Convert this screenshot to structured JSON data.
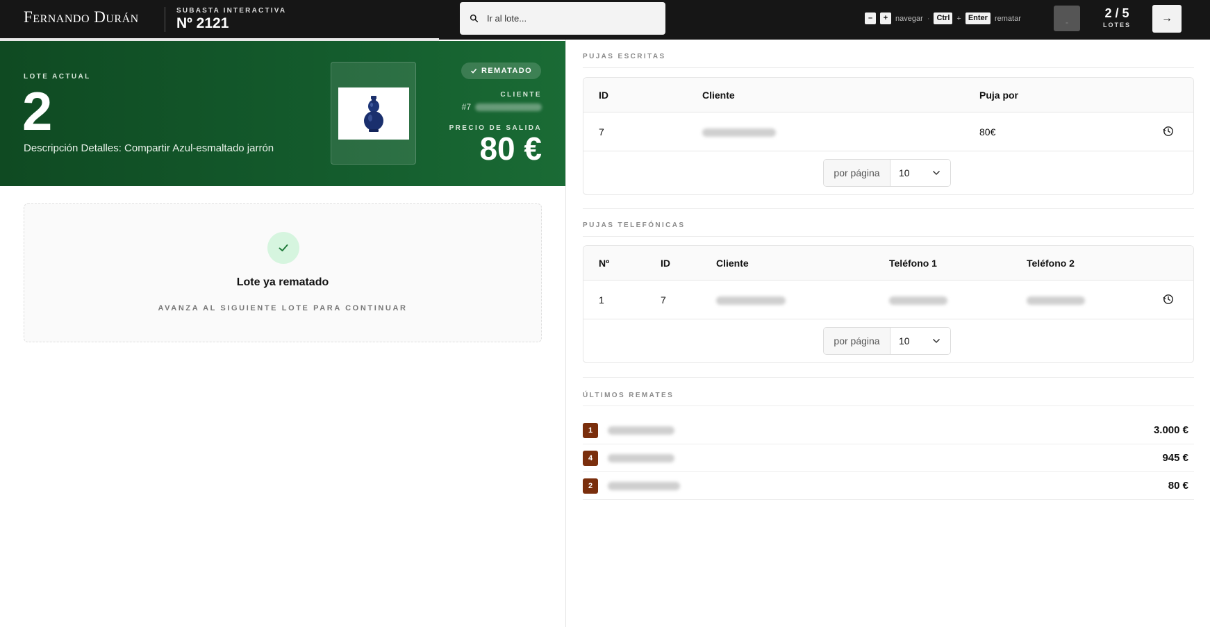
{
  "header": {
    "brand": "Fernando Durán",
    "auction_kicker": "SUBASTA INTERACTIVA",
    "auction_number": "Nº 2121",
    "search_placeholder": "Ir al lote...",
    "hint_minus": "–",
    "hint_plus": "+",
    "hint_navigate": "navegar",
    "hint_ctrl": "Ctrl",
    "hint_enter": "Enter",
    "hint_auction": "rematar",
    "stop_label": "-",
    "lot_counter": "2 / 5",
    "lot_counter_label": "LOTES",
    "next_label": "→",
    "progress_fraction": 0.4
  },
  "current_lot": {
    "kicker": "LOTE ACTUAL",
    "number": "2",
    "description": "Descripción Detalles: Compartir Azul-esmaltado jarrón",
    "status_badge": "REMATADO",
    "client_label": "CLIENTE",
    "client_id": "#7",
    "start_price_label": "PRECIO DE SALIDA",
    "start_price": "80 €",
    "image_icon": "vase-icon"
  },
  "sold_notice": {
    "title": "Lote ya rematado",
    "subtitle": "AVANZA AL SIGUIENTE LOTE PARA CONTINUAR"
  },
  "written_bids": {
    "title": "PUJAS ESCRITAS",
    "columns": [
      "ID",
      "Cliente",
      "Puja por"
    ],
    "rows": [
      {
        "id": "7",
        "bid": "80€"
      }
    ],
    "per_page_label": "por página",
    "per_page_value": "10"
  },
  "phone_bids": {
    "title": "PUJAS TELEFÓNICAS",
    "columns": [
      "Nº",
      "ID",
      "Cliente",
      "Teléfono 1",
      "Teléfono 2"
    ],
    "rows": [
      {
        "n": "1",
        "id": "7"
      }
    ],
    "per_page_label": "por página",
    "per_page_value": "10"
  },
  "last_sales": {
    "title": "ÚLTIMOS REMATES",
    "items": [
      {
        "lot": "1",
        "amount": "3.000 €"
      },
      {
        "lot": "4",
        "amount": "945 €"
      },
      {
        "lot": "2",
        "amount": "80 €"
      }
    ]
  },
  "colors": {
    "topbar": "#161616",
    "hero_green": "#145c2d",
    "lot_badge": "#7a2e0c",
    "success_bg": "#d6f5df"
  }
}
